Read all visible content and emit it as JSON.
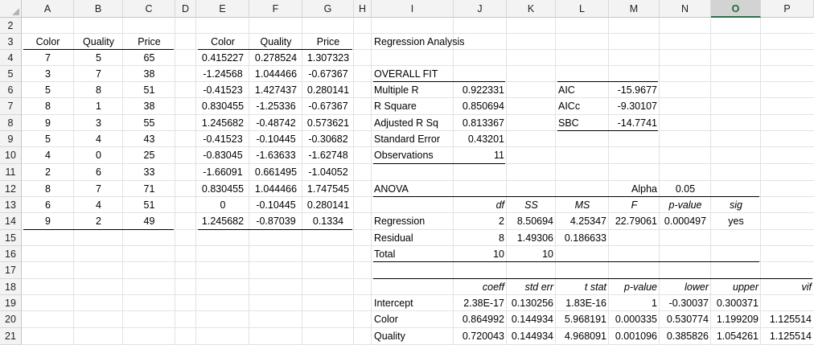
{
  "columns": [
    "A",
    "B",
    "C",
    "D",
    "E",
    "F",
    "G",
    "H",
    "I",
    "J",
    "K",
    "L",
    "M",
    "N",
    "O",
    "P"
  ],
  "selected_column": "O",
  "rows": [
    "2",
    "3",
    "4",
    "5",
    "6",
    "7",
    "8",
    "9",
    "10",
    "11",
    "12",
    "13",
    "14",
    "15",
    "16",
    "17",
    "18",
    "19",
    "20",
    "21"
  ],
  "colors": {
    "header_bg": "#f3f3f3",
    "selected_header_text": "#1e6b3a",
    "selected_header_underline": "#217346",
    "gridline": "#e2e2e2"
  },
  "raw_table": {
    "headers": [
      "Color",
      "Quality",
      "Price"
    ],
    "rows": [
      [
        "7",
        "5",
        "65"
      ],
      [
        "3",
        "7",
        "38"
      ],
      [
        "5",
        "8",
        "51"
      ],
      [
        "8",
        "1",
        "38"
      ],
      [
        "9",
        "3",
        "55"
      ],
      [
        "5",
        "4",
        "43"
      ],
      [
        "4",
        "0",
        "25"
      ],
      [
        "2",
        "6",
        "33"
      ],
      [
        "8",
        "7",
        "71"
      ],
      [
        "6",
        "4",
        "51"
      ],
      [
        "9",
        "2",
        "49"
      ]
    ]
  },
  "std_table": {
    "headers": [
      "Color",
      "Quality",
      "Price"
    ],
    "rows": [
      [
        "0.415227",
        "0.278524",
        "1.307323"
      ],
      [
        "-1.24568",
        "1.044466",
        "-0.67367"
      ],
      [
        "-0.41523",
        "1.427437",
        "0.280141"
      ],
      [
        "0.830455",
        "-1.25336",
        "-0.67367"
      ],
      [
        "1.245682",
        "-0.48742",
        "0.573621"
      ],
      [
        "-0.41523",
        "-0.10445",
        "-0.30682"
      ],
      [
        "-0.83045",
        "-1.63633",
        "-1.62748"
      ],
      [
        "-1.66091",
        "0.661495",
        "-1.04052"
      ],
      [
        "0.830455",
        "1.044466",
        "1.747545"
      ],
      [
        "0",
        "-0.10445",
        "0.280141"
      ],
      [
        "1.245682",
        "-0.87039",
        "0.1334"
      ]
    ]
  },
  "regression": {
    "title": "Regression Analysis",
    "overall_fit_label": "OVERALL FIT",
    "fit": [
      {
        "label": "Multiple R",
        "value": "0.922331"
      },
      {
        "label": "R Square",
        "value": "0.850694"
      },
      {
        "label": "Adjusted R Sq",
        "value": "0.813367"
      },
      {
        "label": "Standard Error",
        "value": "0.43201"
      },
      {
        "label": "Observations",
        "value": "11"
      }
    ],
    "ic": [
      {
        "label": "AIC",
        "value": "-15.9677"
      },
      {
        "label": "AICc",
        "value": "-9.30107"
      },
      {
        "label": "SBC",
        "value": "-14.7741"
      }
    ],
    "anova_label": "ANOVA",
    "alpha_label": "Alpha",
    "alpha_value": "0.05",
    "anova_headers": [
      "df",
      "SS",
      "MS",
      "F",
      "p-value",
      "sig"
    ],
    "anova_rows": [
      {
        "label": "Regression",
        "vals": [
          "2",
          "8.50694",
          "4.25347",
          "22.79061",
          "0.000497",
          "yes"
        ]
      },
      {
        "label": "Residual",
        "vals": [
          "8",
          "1.49306",
          "0.186633",
          "",
          "",
          ""
        ]
      },
      {
        "label": "Total",
        "vals": [
          "10",
          "10",
          "",
          "",
          "",
          ""
        ]
      }
    ],
    "coef_headers": [
      "coeff",
      "std err",
      "t stat",
      "p-value",
      "lower",
      "upper",
      "vif"
    ],
    "coef_rows": [
      {
        "label": "Intercept",
        "vals": [
          "2.38E-17",
          "0.130256",
          "1.83E-16",
          "1",
          "-0.30037",
          "0.300371",
          ""
        ]
      },
      {
        "label": "Color",
        "vals": [
          "0.864992",
          "0.144934",
          "5.968191",
          "0.000335",
          "0.530774",
          "1.199209",
          "1.125514"
        ]
      },
      {
        "label": "Quality",
        "vals": [
          "0.720043",
          "0.144934",
          "4.968091",
          "0.001096",
          "0.385826",
          "1.054261",
          "1.125514"
        ]
      }
    ]
  }
}
